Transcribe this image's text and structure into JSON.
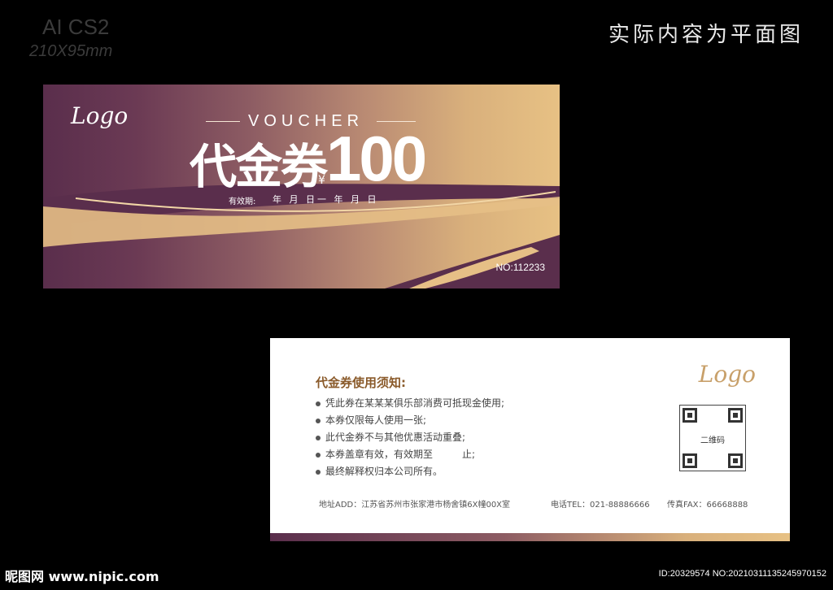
{
  "meta": {
    "app_version": "AI CS2",
    "size": "210X95mm",
    "note": "实际内容为平面图"
  },
  "front": {
    "logo": "Logo",
    "voucher_label": "VOUCHER",
    "title": "代金券",
    "currency": "¥",
    "amount": "100",
    "validity_label": "有效期:",
    "validity_text": "年 月 日一 年 月 日",
    "serial": "NO:112233",
    "colors": {
      "dark": "#5a2e4c",
      "gold": "#e7c184"
    }
  },
  "back": {
    "logo": "Logo",
    "notice_title": "代金券使用须知:",
    "rules": [
      "凭此券在某某某俱乐部消费可抵现金使用;",
      "本券仅限每人使用一张;",
      "此代金券不与其他优惠活动重叠;",
      "本券盖章有效，有效期至　　　止;",
      "最终解释权归本公司所有。"
    ],
    "qr_label": "二维码",
    "address": "地址ADD：江苏省苏州市张家港市杨舍镇6X幢00X室",
    "phone": "电话TEL：021-88886666",
    "fax": "传真FAX：66668888"
  },
  "watermark": {
    "site": "昵图网 www.nipic.com",
    "id": "ID:20329574 NO:20210311135245970152"
  }
}
